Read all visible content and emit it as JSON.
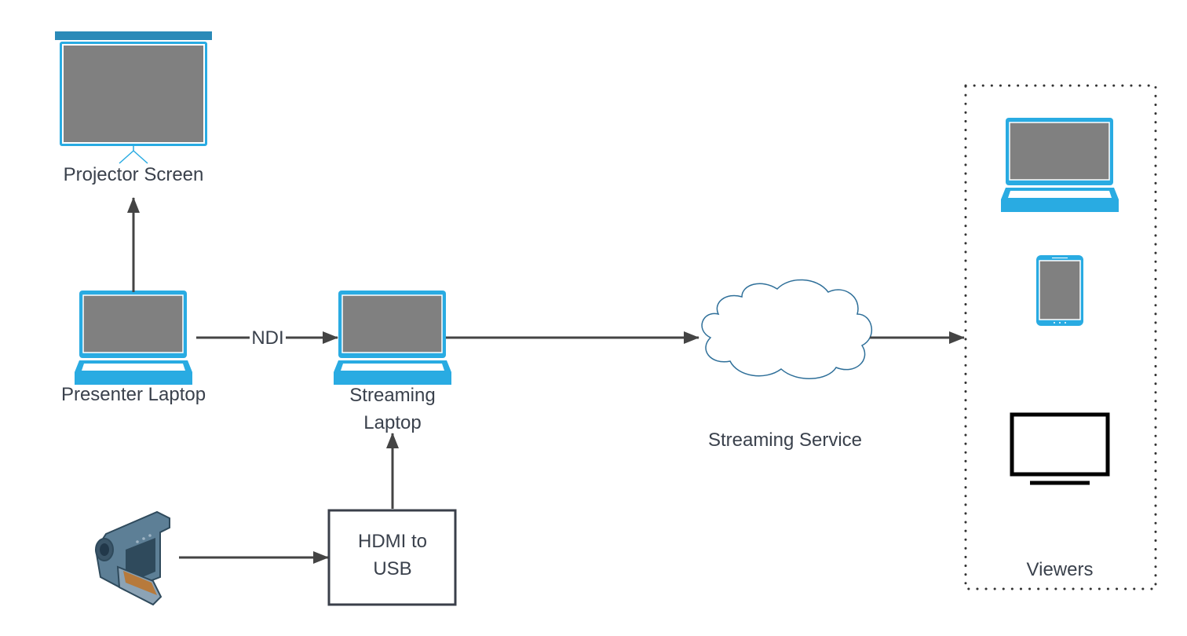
{
  "nodes": {
    "projector": {
      "label": "Projector Screen",
      "icon": "projector-screen-icon"
    },
    "presenter_laptop": {
      "label": "Presenter Laptop",
      "icon": "laptop-icon"
    },
    "streaming_laptop": {
      "label_line1": "Streaming",
      "label_line2": "Laptop",
      "icon": "laptop-icon"
    },
    "camera": {
      "icon": "video-camera-icon"
    },
    "hdmi_usb": {
      "label_line1": "HDMI to",
      "label_line2": "USB"
    },
    "streaming_service": {
      "label": "Streaming Service",
      "icon": "cloud-icon"
    },
    "viewers": {
      "label": "Viewers",
      "devices": [
        "laptop-icon",
        "tablet-icon",
        "tv-monitor-icon"
      ]
    }
  },
  "edges": [
    {
      "from": "presenter_laptop",
      "to": "projector",
      "label": ""
    },
    {
      "from": "presenter_laptop",
      "to": "streaming_laptop",
      "label": "NDI"
    },
    {
      "from": "streaming_laptop",
      "to": "streaming_service",
      "label": ""
    },
    {
      "from": "streaming_service",
      "to": "viewers",
      "label": ""
    },
    {
      "from": "camera",
      "to": "hdmi_usb",
      "label": ""
    },
    {
      "from": "hdmi_usb",
      "to": "streaming_laptop",
      "label": ""
    }
  ],
  "colors": {
    "device_blue": "#29abe2",
    "screen_gray": "#808080",
    "projector_bar": "#2a8ab8",
    "line": "#444444",
    "text": "#3a414c"
  }
}
